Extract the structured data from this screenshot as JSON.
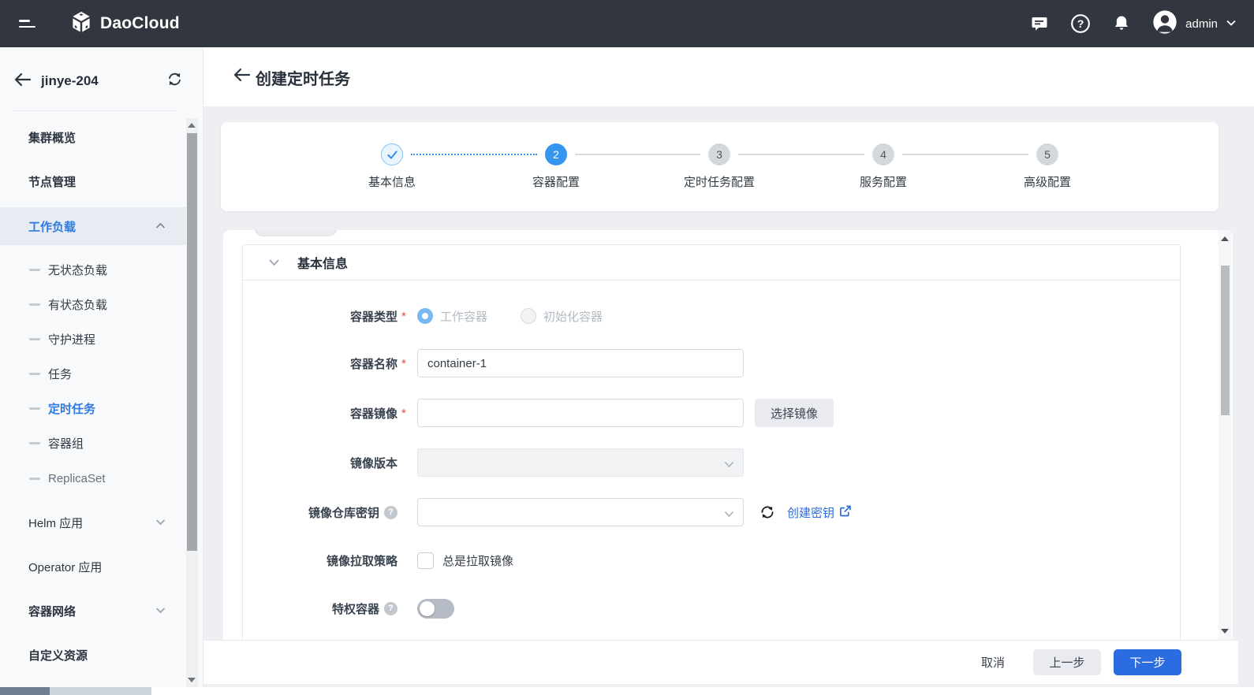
{
  "topbar": {
    "brand": "DaoCloud",
    "user": "admin"
  },
  "sidebar": {
    "cluster": "jinye-204",
    "items": [
      {
        "label": "集群概览"
      },
      {
        "label": "节点管理"
      },
      {
        "label": "工作负载"
      },
      {
        "label": "无状态负载"
      },
      {
        "label": "有状态负载"
      },
      {
        "label": "守护进程"
      },
      {
        "label": "任务"
      },
      {
        "label": "定时任务"
      },
      {
        "label": "容器组"
      },
      {
        "label": "ReplicaSet"
      },
      {
        "label": "Helm 应用"
      },
      {
        "label": "Operator 应用"
      },
      {
        "label": "容器网络"
      },
      {
        "label": "自定义资源"
      }
    ]
  },
  "page": {
    "title": "创建定时任务"
  },
  "stepper": {
    "steps": [
      {
        "label": "基本信息",
        "state": "done"
      },
      {
        "label": "容器配置",
        "state": "active",
        "num": "2"
      },
      {
        "label": "定时任务配置",
        "state": "future",
        "num": "3"
      },
      {
        "label": "服务配置",
        "state": "future",
        "num": "4"
      },
      {
        "label": "高级配置",
        "state": "future",
        "num": "5"
      }
    ]
  },
  "form": {
    "section_title": "基本信息",
    "container_type": {
      "label": "容器类型",
      "required": "*",
      "options": [
        {
          "label": "工作容器",
          "selected": true
        },
        {
          "label": "初始化容器",
          "selected": false
        }
      ]
    },
    "container_name": {
      "label": "容器名称",
      "required": "*",
      "value": "container-1"
    },
    "container_image": {
      "label": "容器镜像",
      "required": "*",
      "value": "",
      "button": "选择镜像"
    },
    "image_version": {
      "label": "镜像版本",
      "value": "",
      "disabled": true
    },
    "registry_secret": {
      "label": "镜像仓库密钥",
      "value": "",
      "link": "创建密钥"
    },
    "pull_policy": {
      "label": "镜像拉取策略",
      "checkbox_label": "总是拉取镜像",
      "checked": false
    },
    "privileged": {
      "label": "特权容器",
      "enabled": false
    }
  },
  "footer": {
    "cancel": "取消",
    "prev": "上一步",
    "next": "下一步"
  },
  "icons": {
    "topbar": [
      "menu-icon",
      "daocloud-logo-icon",
      "chat-icon",
      "help-icon",
      "bell-icon",
      "avatar-icon",
      "chevron-down-icon"
    ],
    "misc": [
      "back-arrow-icon",
      "cluster-switch-icon",
      "refresh-icon",
      "external-link-icon",
      "question-icon"
    ]
  },
  "colors": {
    "topbar_bg": "#32373f",
    "accent_blue": "#2b6de0",
    "stepper_blue": "#3696ef",
    "sidebar_active": "#2f7ae0",
    "page_bg": "#edeff3",
    "panel_bg": "#ffffff",
    "required_red": "#e54545",
    "disabled_fill": "#f1f2f4"
  }
}
